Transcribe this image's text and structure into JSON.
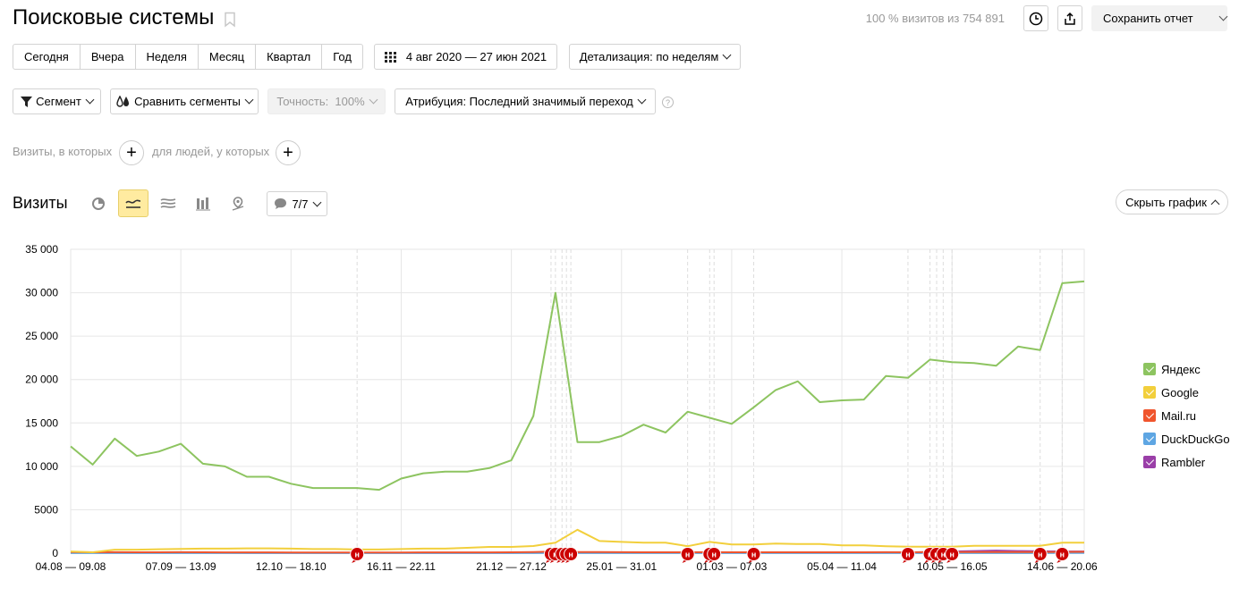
{
  "header": {
    "title": "Поисковые системы",
    "visits_share": "100 % визитов из 754 891",
    "save_report": "Сохранить отчет"
  },
  "periods": [
    "Сегодня",
    "Вчера",
    "Неделя",
    "Месяц",
    "Квартал",
    "Год"
  ],
  "date_range": "4 авг 2020 — 27 июн 2021",
  "detail": "Детализация: по неделям",
  "filters": {
    "segment": "Сегмент",
    "compare": "Сравнить сегменты",
    "accuracy": "Точность:  100%",
    "attribution": "Атрибуция: Последний значимый переход",
    "help": "?"
  },
  "conditions": {
    "visits_where": "Визиты, в которых",
    "people_where": "для людей, у которых",
    "plus": "+"
  },
  "chart_section": {
    "title": "Визиты",
    "notes_count": "7/7",
    "hide_chart": "Скрыть график"
  },
  "chart_data": {
    "type": "line",
    "x": [
      "04.08 — 09.08",
      "",
      "",
      "",
      "",
      "07.09 — 13.09",
      "",
      "",
      "",
      "",
      "12.10 — 18.10",
      "",
      "",
      "",
      "",
      "16.11 — 22.11",
      "",
      "",
      "",
      "",
      "21.12 — 27.12",
      "",
      "",
      "",
      "",
      "25.01 — 31.01",
      "",
      "",
      "",
      "",
      "01.03 — 07.03",
      "",
      "",
      "",
      "",
      "05.04 — 11.04",
      "",
      "",
      "",
      "",
      "10.05 — 16.05",
      "",
      "",
      "",
      "",
      "14.06 — 20.06",
      ""
    ],
    "x_tick_labels": [
      "04.08 — 09.08",
      "07.09 — 13.09",
      "12.10 — 18.10",
      "16.11 — 22.11",
      "21.12 — 27.12",
      "25.01 — 31.01",
      "01.03 — 07.03",
      "05.04 — 11.04",
      "10.05 — 16.05",
      "14.06 — 20.06"
    ],
    "y_ticks": [
      "0",
      "5000",
      "10 000",
      "15 000",
      "20 000",
      "25 000",
      "30 000",
      "35 000"
    ],
    "ylim": [
      0,
      35000
    ],
    "series": [
      {
        "name": "Яндекс",
        "color": "#8dc460",
        "values": [
          12300,
          10200,
          13200,
          11200,
          11700,
          12600,
          10300,
          10000,
          8800,
          8800,
          8000,
          7500,
          7500,
          7500,
          7300,
          8600,
          9200,
          9400,
          9400,
          9800,
          10700,
          15800,
          30000,
          12800,
          12800,
          13500,
          14800,
          13900,
          16300,
          15600,
          14900,
          16800,
          18800,
          19800,
          17400,
          17600,
          17700,
          20400,
          20200,
          22300,
          22000,
          21900,
          21600,
          23800,
          23400,
          31100,
          31300
        ]
      },
      {
        "name": "Google",
        "color": "#f2cf3c",
        "values": [
          200,
          100,
          400,
          400,
          450,
          480,
          520,
          520,
          560,
          560,
          520,
          470,
          470,
          420,
          420,
          470,
          520,
          520,
          620,
          720,
          720,
          820,
          1200,
          2700,
          1400,
          1300,
          1200,
          1200,
          800,
          1300,
          1000,
          1000,
          1100,
          1050,
          1050,
          900,
          900,
          800,
          750,
          750,
          750,
          850,
          850,
          850,
          850,
          1200,
          1200
        ]
      },
      {
        "name": "Mail.ru",
        "color": "#f0552d",
        "values": [
          120,
          100,
          110,
          100,
          100,
          110,
          100,
          90,
          90,
          90,
          80,
          80,
          80,
          80,
          80,
          80,
          90,
          90,
          90,
          90,
          100,
          120,
          200,
          130,
          120,
          110,
          100,
          100,
          100,
          110,
          100,
          100,
          100,
          100,
          100,
          100,
          100,
          110,
          100,
          120,
          120,
          120,
          120,
          120,
          120,
          140,
          150
        ]
      },
      {
        "name": "DuckDuckGo",
        "color": "#5ea6e3",
        "values": [
          10,
          10,
          10,
          10,
          10,
          10,
          10,
          10,
          10,
          10,
          10,
          10,
          10,
          10,
          10,
          10,
          10,
          10,
          10,
          10,
          10,
          15,
          20,
          15,
          15,
          15,
          15,
          15,
          15,
          15,
          15,
          15,
          15,
          15,
          15,
          15,
          15,
          15,
          15,
          15,
          15,
          15,
          15,
          15,
          15,
          20,
          20
        ]
      },
      {
        "name": "Rambler",
        "color": "#9a3fa8",
        "values": [
          60,
          55,
          55,
          50,
          50,
          50,
          50,
          50,
          45,
          45,
          45,
          45,
          45,
          45,
          45,
          45,
          45,
          45,
          45,
          45,
          45,
          60,
          90,
          60,
          55,
          55,
          50,
          50,
          50,
          55,
          50,
          50,
          60,
          60,
          60,
          60,
          60,
          70,
          80,
          120,
          200,
          250,
          300,
          250,
          220,
          200,
          200
        ]
      }
    ],
    "notes": [
      13,
      21.8,
      22,
      22.3,
      22.5,
      22.7,
      28,
      29,
      29.2,
      31,
      38,
      39,
      39.3,
      39.6,
      40,
      44,
      45
    ],
    "note_label": "н",
    "legend_position": "right",
    "grid": true
  }
}
